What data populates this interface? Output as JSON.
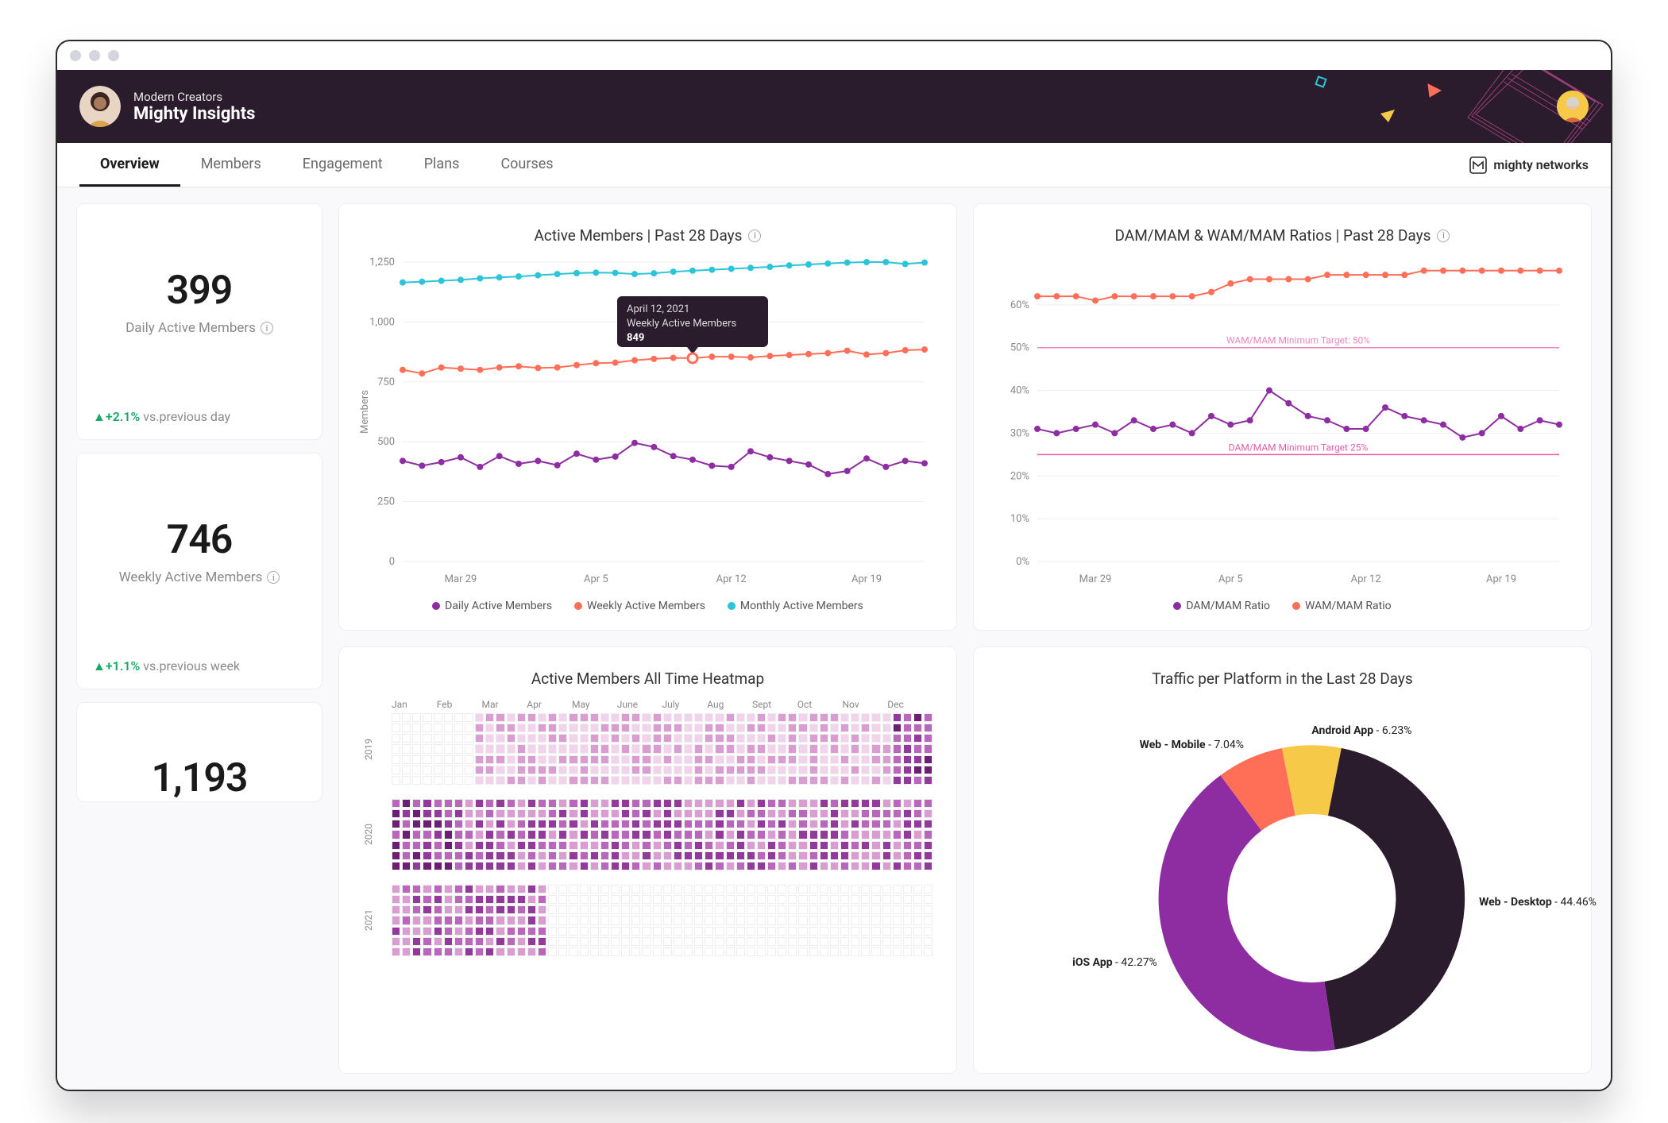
{
  "header": {
    "community": "Modern Creators",
    "title": "Mighty Insights",
    "brand_right": "mighty networks"
  },
  "tabs": [
    {
      "label": "Overview",
      "active": true
    },
    {
      "label": "Members",
      "active": false
    },
    {
      "label": "Engagement",
      "active": false
    },
    {
      "label": "Plans",
      "active": false
    },
    {
      "label": "Courses",
      "active": false
    }
  ],
  "kpis": {
    "dam": {
      "value": "399",
      "label": "Daily Active Members",
      "delta": "+2.1%",
      "vs": "vs.previous day"
    },
    "wam": {
      "value": "746",
      "label": "Weekly Active Members",
      "delta": "+1.1%",
      "vs": "vs.previous week"
    },
    "mam": {
      "value": "1,193"
    }
  },
  "charts": {
    "active": {
      "title": "Active Members | Past 28 Days",
      "legend": {
        "dam": "Daily Active Members",
        "wam": "Weekly Active Members",
        "mam": "Monthly Active Members"
      },
      "tooltip": {
        "date": "April 12, 2021",
        "label": "Weekly Active Members",
        "value": "849"
      },
      "y_title": "Members"
    },
    "ratios": {
      "title": "DAM/MAM & WAM/MAM Ratios | Past 28 Days",
      "legend": {
        "dam": "DAM/MAM Ratio",
        "wam": "WAM/MAM Ratio"
      },
      "target_wam": "WAM/MAM Minimum Target: 50%",
      "target_dam": "DAM/MAM Minimum Target 25%"
    },
    "heatmap": {
      "title": "Active Members All Time Heatmap",
      "months": [
        "Jan",
        "Feb",
        "Mar",
        "Apr",
        "May",
        "June",
        "July",
        "Aug",
        "Sept",
        "Oct",
        "Nov",
        "Dec"
      ]
    },
    "traffic": {
      "title": "Traffic per Platform in the Last 28 Days",
      "labels": {
        "android": "Android App",
        "webmobile": "Web - Mobile",
        "ios": "iOS App",
        "webdesktop": "Web - Desktop"
      }
    }
  },
  "colors": {
    "purple": "#8e2ca1",
    "coral": "#ff6f57",
    "teal": "#2bc4d8",
    "yellow": "#f7c948",
    "dark": "#2a1b2d",
    "magenta": "#e85aa8",
    "pink": "#ea86c1",
    "green": "#17a864"
  },
  "chart_data": [
    {
      "id": "active_members",
      "type": "line",
      "title": "Active Members | Past 28 Days",
      "xlabel": "",
      "ylabel": "Members",
      "ylim": [
        0,
        1250
      ],
      "y_ticks": [
        0,
        250,
        500,
        750,
        1000,
        1250
      ],
      "x_tick_labels": [
        "Mar 29",
        "Apr 5",
        "Apr 12",
        "Apr 19"
      ],
      "x": [
        1,
        2,
        3,
        4,
        5,
        6,
        7,
        8,
        9,
        10,
        11,
        12,
        13,
        14,
        15,
        16,
        17,
        18,
        19,
        20,
        21,
        22,
        23,
        24,
        25,
        26,
        27,
        28
      ],
      "series": [
        {
          "name": "Monthly Active Members",
          "color": "#2bc4d8",
          "values": [
            1165,
            1168,
            1172,
            1176,
            1182,
            1186,
            1190,
            1195,
            1200,
            1204,
            1206,
            1205,
            1200,
            1203,
            1210,
            1214,
            1218,
            1222,
            1226,
            1230,
            1236,
            1240,
            1244,
            1248,
            1250,
            1250,
            1242,
            1248
          ]
        },
        {
          "name": "Weekly Active Members",
          "color": "#ff6f57",
          "values": [
            800,
            785,
            810,
            805,
            800,
            810,
            815,
            808,
            810,
            820,
            828,
            830,
            840,
            846,
            850,
            849,
            855,
            855,
            852,
            858,
            862,
            866,
            870,
            880,
            864,
            870,
            882,
            885
          ]
        },
        {
          "name": "Daily Active Members",
          "color": "#8e2ca1",
          "values": [
            420,
            400,
            415,
            435,
            395,
            440,
            408,
            420,
            402,
            450,
            425,
            438,
            495,
            478,
            440,
            425,
            400,
            395,
            460,
            435,
            420,
            405,
            365,
            378,
            430,
            395,
            420,
            410
          ]
        }
      ],
      "tooltip": {
        "x": 16,
        "series": "Weekly Active Members",
        "date": "April 12, 2021",
        "value": 849
      }
    },
    {
      "id": "ratios",
      "type": "line",
      "title": "DAM/MAM & WAM/MAM Ratios | Past 28 Days",
      "xlabel": "",
      "ylabel": "",
      "ylim": [
        0,
        70
      ],
      "y_unit": "%",
      "y_ticks": [
        0,
        10,
        20,
        30,
        40,
        50,
        60
      ],
      "x_tick_labels": [
        "Mar 29",
        "Apr 5",
        "Apr 12",
        "Apr 19"
      ],
      "x": [
        1,
        2,
        3,
        4,
        5,
        6,
        7,
        8,
        9,
        10,
        11,
        12,
        13,
        14,
        15,
        16,
        17,
        18,
        19,
        20,
        21,
        22,
        23,
        24,
        25,
        26,
        27,
        28
      ],
      "series": [
        {
          "name": "WAM/MAM Ratio",
          "color": "#ff6f57",
          "values": [
            62,
            62,
            62,
            61,
            62,
            62,
            62,
            62,
            62,
            63,
            65,
            66,
            66,
            66,
            66,
            67,
            67,
            67,
            67,
            67,
            68,
            68,
            68,
            68,
            68,
            68,
            68,
            68
          ]
        },
        {
          "name": "DAM/MAM Ratio",
          "color": "#8e2ca1",
          "values": [
            31,
            30,
            31,
            32,
            30,
            33,
            31,
            32,
            30,
            34,
            32,
            33,
            40,
            37,
            34,
            33,
            31,
            31,
            36,
            34,
            33,
            32,
            29,
            30,
            34,
            31,
            33,
            32
          ]
        }
      ],
      "reference_lines": [
        {
          "label": "WAM/MAM Minimum Target: 50%",
          "value": 50,
          "color": "#ea86c1"
        },
        {
          "label": "DAM/MAM Minimum Target 25%",
          "value": 25,
          "color": "#e85aa8"
        }
      ]
    },
    {
      "id": "heatmap",
      "type": "heatmap",
      "title": "Active Members All Time Heatmap",
      "x_categories": [
        "Jan",
        "Feb",
        "Mar",
        "Apr",
        "May",
        "June",
        "July",
        "Aug",
        "Sept",
        "Oct",
        "Nov",
        "Dec"
      ],
      "y_categories": [
        "2019",
        "2020",
        "2021"
      ],
      "intensity_scale": [
        0,
        5
      ],
      "note": "Per-day intensities 0-5 rendered procedurally; 2019 begins ~week 9 low intensity rising late year, 2020 full-year moderate-high, 2021 Jan-mid-Apr moderate then empty."
    },
    {
      "id": "traffic",
      "type": "pie",
      "title": "Traffic per Platform in the Last 28 Days",
      "series": [
        {
          "name": "Web - Desktop",
          "value": 44.46,
          "color": "#2a1b2d"
        },
        {
          "name": "iOS App",
          "value": 42.27,
          "color": "#8e2ca1"
        },
        {
          "name": "Web - Mobile",
          "value": 7.04,
          "color": "#ff6f57"
        },
        {
          "name": "Android App",
          "value": 6.23,
          "color": "#f7c948"
        }
      ],
      "donut_inner_ratio": 0.55
    }
  ]
}
